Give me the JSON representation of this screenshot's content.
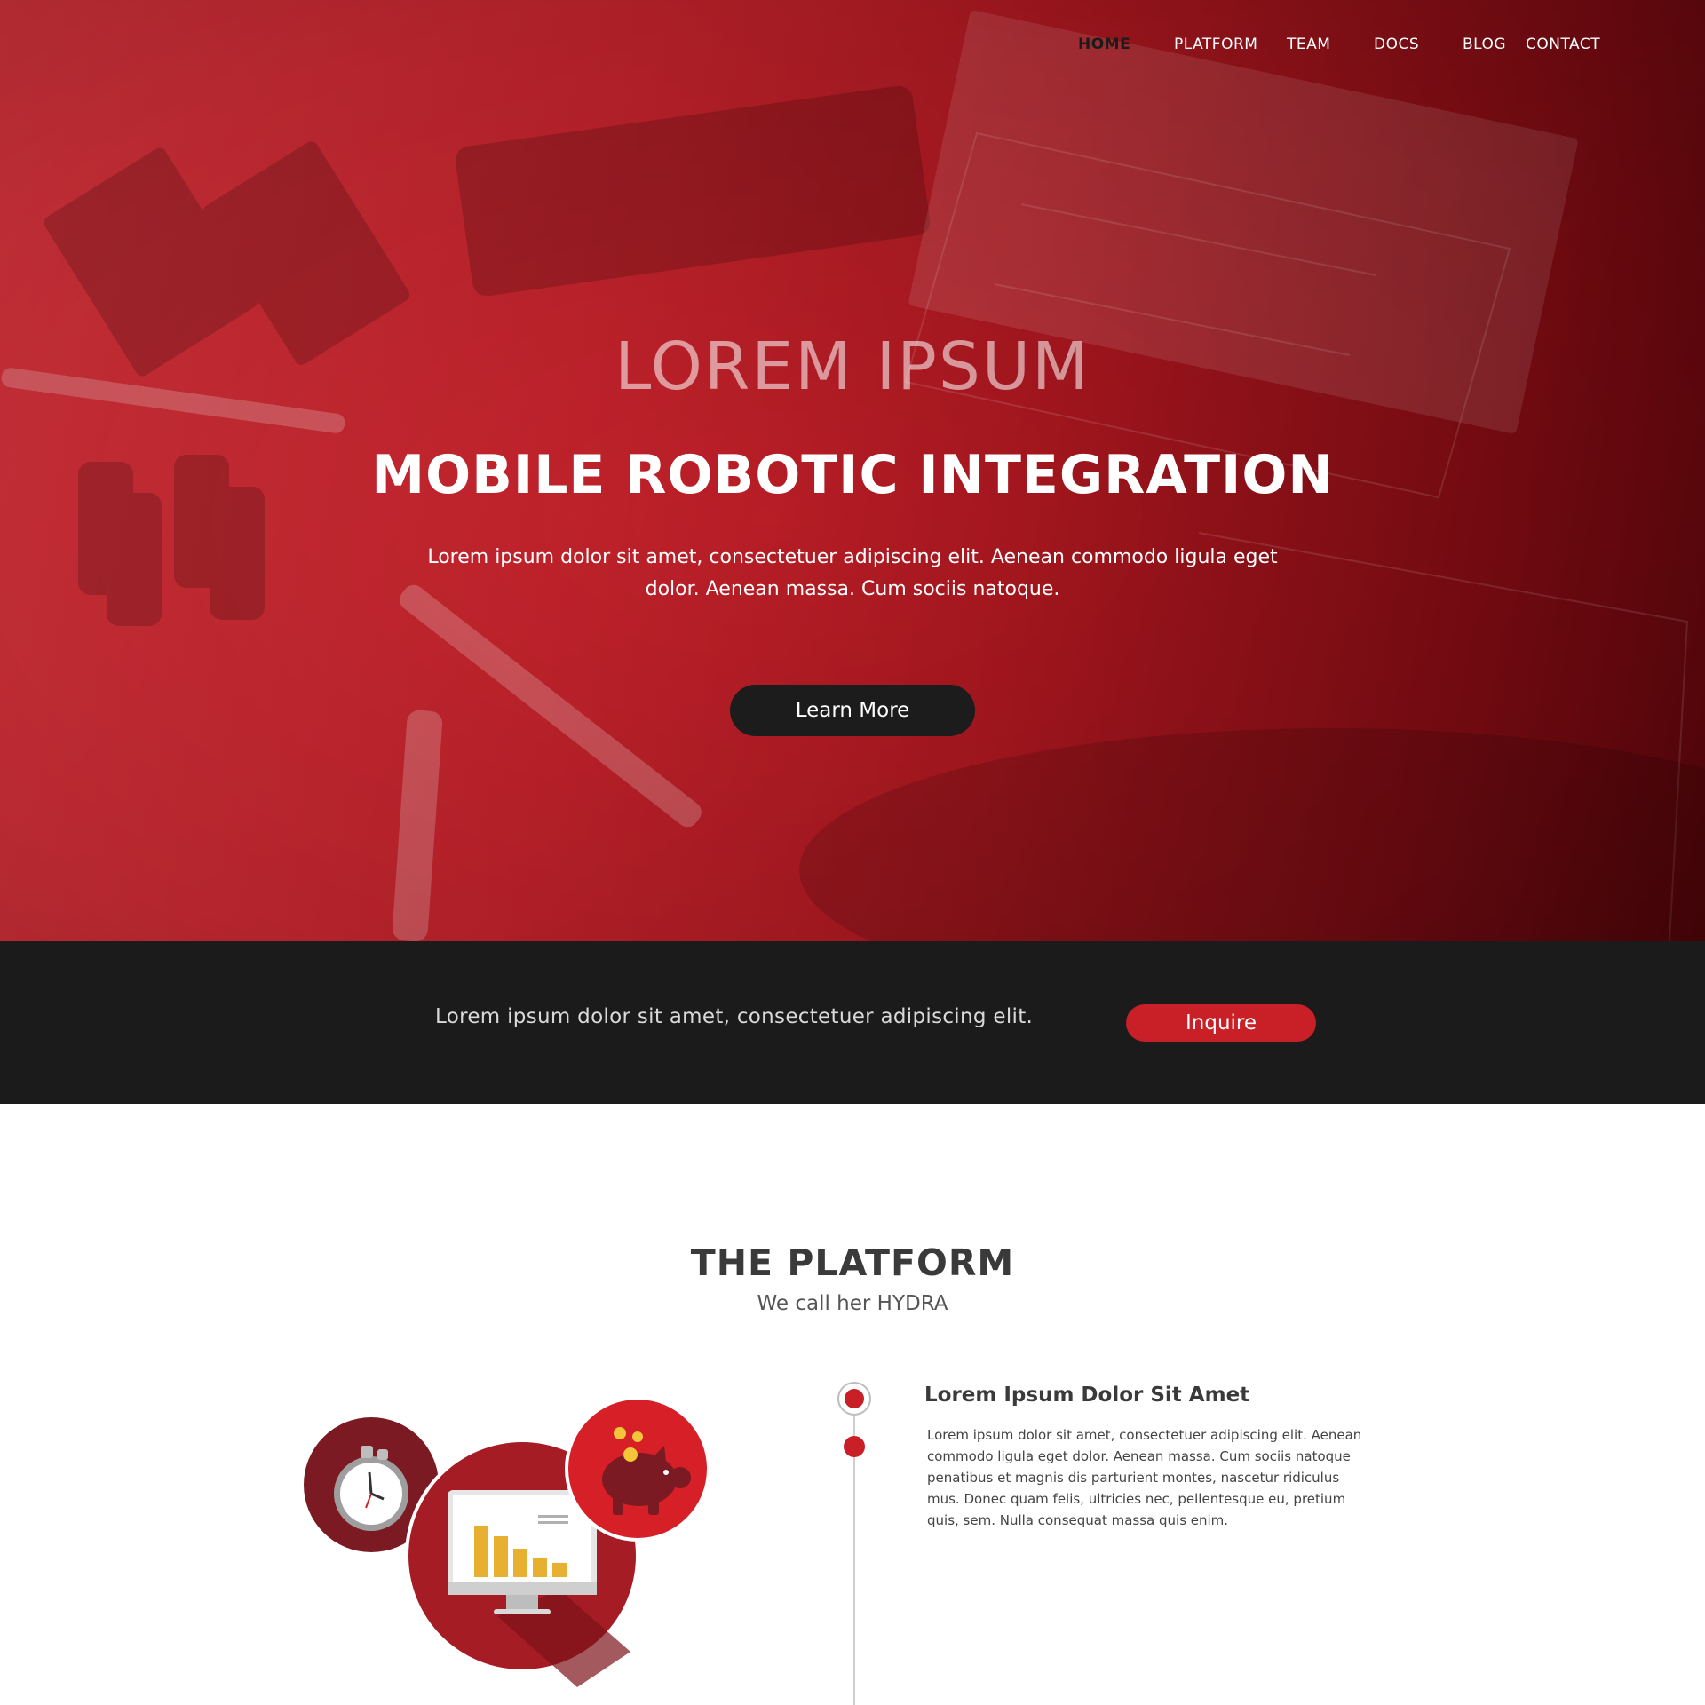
{
  "nav": {
    "items": [
      {
        "label": "HOME",
        "active": true
      },
      {
        "label": "PLATFORM",
        "active": false
      },
      {
        "label": "TEAM",
        "active": false
      },
      {
        "label": "DOCS",
        "active": false
      },
      {
        "label": "BLOG",
        "active": false
      },
      {
        "label": "CONTACT",
        "active": false
      }
    ]
  },
  "hero": {
    "kicker": "LOREM IPSUM",
    "title": "MOBILE ROBOTIC INTEGRATION",
    "description": "Lorem ipsum dolor sit amet, consectetuer adipiscing elit. Aenean commodo ligula eget dolor. Aenean massa. Cum sociis natoque.",
    "button_label": "Learn More"
  },
  "cta": {
    "text": "Lorem ipsum dolor sit amet, consectetuer adipiscing elit.",
    "button_label": "Inquire"
  },
  "platform": {
    "title_prefix": "THE ",
    "title_bold": "PLATFORM",
    "subtitle": "We call her HYDRA",
    "feature": {
      "title": "Lorem Ipsum Dolor Sit Amet",
      "body": "Lorem ipsum dolor sit amet, consectetuer adipiscing elit. Aenean commodo ligula eget dolor. Aenean massa. Cum sociis natoque penatibus et magnis dis parturient montes, nascetur ridiculus mus. Donec quam felis, ultricies nec, pellentesque eu, pretium quis, sem. Nulla consequat massa quis enim."
    }
  },
  "colors": {
    "brand_red": "#c91f26",
    "dark": "#1b1b1b",
    "chart_bar": "#e8b030"
  },
  "icons": [
    "stopwatch-icon",
    "monitor-chart-icon",
    "piggy-bank-icon",
    "coin-icon"
  ]
}
